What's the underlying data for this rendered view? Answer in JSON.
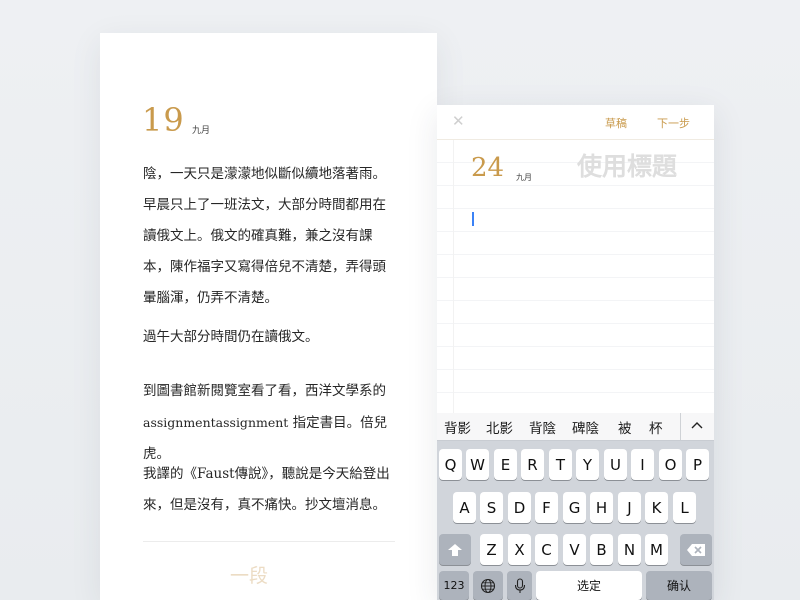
{
  "journal": {
    "day": "19",
    "month": "九月",
    "paragraphs": [
      "陰，一天只是濛濛地似斷似續地落著雨。早晨只上了一班法文，大部分時間都用在讀俄文上。俄文的確真難，兼之沒有課本，陳作福字又寫得倍兒不清楚，弄得頭暈腦渾，仍弄不清楚。",
      "過午大部分時間仍在讀俄文。",
      "到圖書館新閱覽室看了看，西洋文學系的",
      "我譯的《Faust傳說》，聽說是今天給登出來，但是沒有，真不痛快。抄文壇消息。"
    ],
    "assignment_text": "assignmentassignment",
    "assignment_suffix": " 指定書目。倍兒虎。",
    "paragraph_button": "一段"
  },
  "editor": {
    "close_symbol": "✕",
    "draft_label": "草稿",
    "next_label": "下一步",
    "day": "24",
    "month": "九月",
    "title_placeholder": "使用標題"
  },
  "keyboard": {
    "candidates": [
      "背影",
      "北影",
      "背陰",
      "碑陰",
      "被",
      "杯"
    ],
    "row1": [
      "Q",
      "W",
      "E",
      "R",
      "T",
      "Y",
      "U",
      "I",
      "O",
      "P"
    ],
    "row2": [
      "A",
      "S",
      "D",
      "F",
      "G",
      "H",
      "J",
      "K",
      "L"
    ],
    "row3": [
      "Z",
      "X",
      "C",
      "V",
      "B",
      "N",
      "M"
    ],
    "numbers_label": "123",
    "space_label": "选定",
    "confirm_label": "确认"
  },
  "colors": {
    "accent": "#c99a4c",
    "keyboard_bg": "#d1d5db",
    "cursor": "#3b82f6"
  }
}
